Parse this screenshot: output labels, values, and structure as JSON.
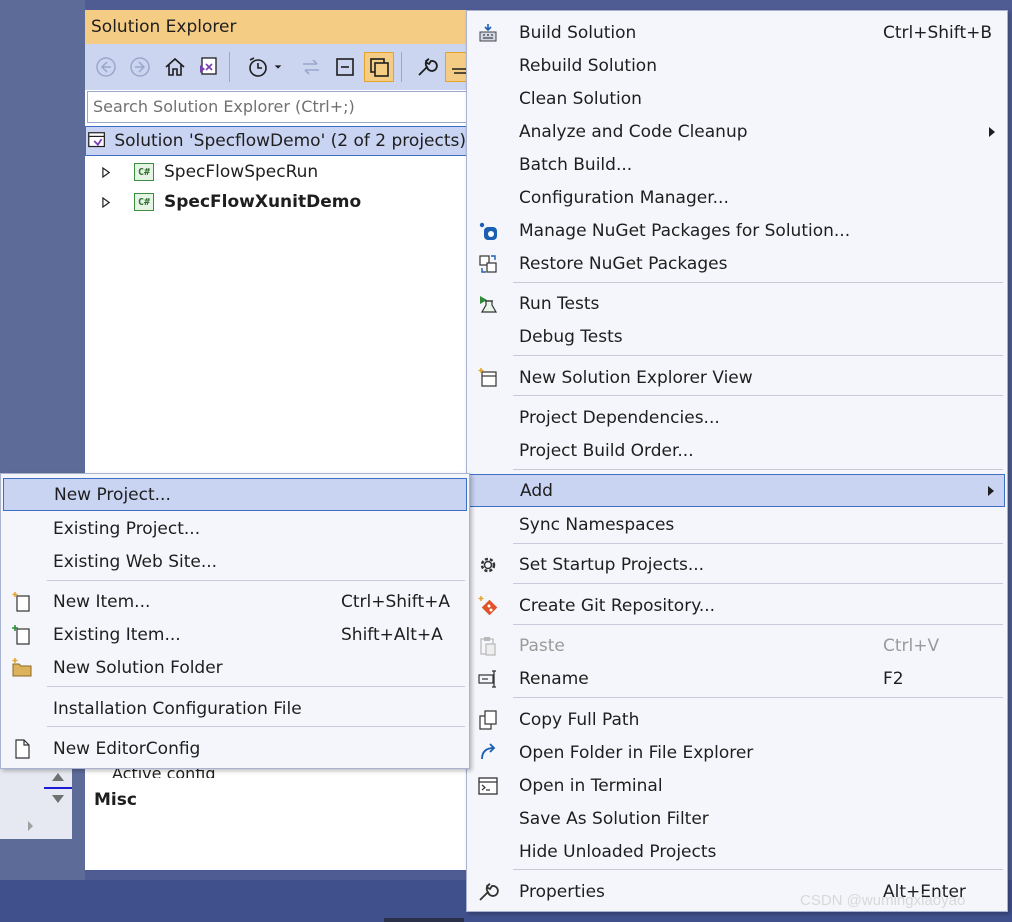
{
  "solution_explorer": {
    "title": "Solution Explorer",
    "search_placeholder": "Search Solution Explorer (Ctrl+;)",
    "solution_label": "Solution 'SpecflowDemo' (2 of 2 projects)",
    "projects": [
      {
        "name": "SpecFlowSpecRun",
        "bold": false
      },
      {
        "name": "SpecFlowXunitDemo",
        "bold": true
      }
    ],
    "cs_badge": "C#"
  },
  "properties": {
    "active_config": "Active config",
    "misc": "Misc"
  },
  "context_menu": {
    "items": {
      "build_solution": {
        "label": "Build Solution",
        "shortcut": "Ctrl+Shift+B"
      },
      "rebuild_solution": {
        "label": "Rebuild Solution"
      },
      "clean_solution": {
        "label": "Clean Solution"
      },
      "analyze": {
        "label": "Analyze and Code Cleanup"
      },
      "batch_build": {
        "label": "Batch Build..."
      },
      "config_manager": {
        "label": "Configuration Manager..."
      },
      "manage_nuget": {
        "label": "Manage NuGet Packages for Solution..."
      },
      "restore_nuget": {
        "label": "Restore NuGet Packages"
      },
      "run_tests": {
        "label": "Run Tests"
      },
      "debug_tests": {
        "label": "Debug Tests"
      },
      "new_se_view": {
        "label": "New Solution Explorer View"
      },
      "project_deps": {
        "label": "Project Dependencies..."
      },
      "build_order": {
        "label": "Project Build Order..."
      },
      "add": {
        "label": "Add"
      },
      "sync_ns": {
        "label": "Sync Namespaces"
      },
      "startup": {
        "label": "Set Startup Projects..."
      },
      "git_repo": {
        "label": "Create Git Repository..."
      },
      "paste": {
        "label": "Paste",
        "shortcut": "Ctrl+V"
      },
      "rename": {
        "label": "Rename",
        "shortcut": "F2"
      },
      "copy_path": {
        "label": "Copy Full Path"
      },
      "open_folder": {
        "label": "Open Folder in File Explorer"
      },
      "open_terminal": {
        "label": "Open in Terminal"
      },
      "save_filter": {
        "label": "Save As Solution Filter"
      },
      "hide_unloaded": {
        "label": "Hide Unloaded Projects"
      },
      "properties": {
        "label": "Properties",
        "shortcut": "Alt+Enter"
      }
    }
  },
  "add_submenu": {
    "items": {
      "new_project": {
        "label": "New Project..."
      },
      "existing_project": {
        "label": "Existing Project..."
      },
      "existing_website": {
        "label": "Existing Web Site..."
      },
      "new_item": {
        "label": "New Item...",
        "shortcut": "Ctrl+Shift+A"
      },
      "existing_item": {
        "label": "Existing Item...",
        "shortcut": "Shift+Alt+A"
      },
      "new_folder": {
        "label": "New Solution Folder"
      },
      "install_config": {
        "label": "Installation Configuration File"
      },
      "editorconfig": {
        "label": "New EditorConfig"
      }
    }
  },
  "watermark": "CSDN @wumingxiaoyao",
  "colors": {
    "accent": "#f5cc84",
    "selection": "#c9d3f2",
    "selection_border": "#3f6ec6",
    "background": "#4f5b93"
  }
}
